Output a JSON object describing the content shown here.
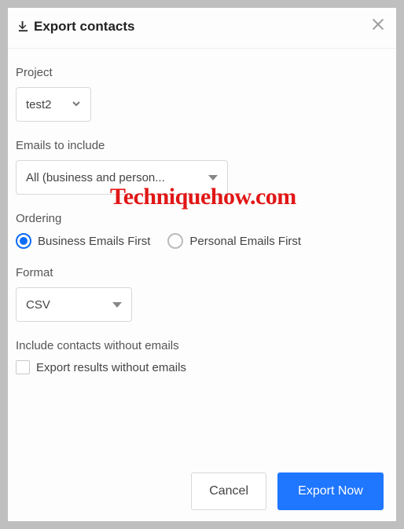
{
  "header": {
    "title": "Export contacts"
  },
  "watermark": "Techniquehow.com",
  "project": {
    "label": "Project",
    "value": "test2"
  },
  "emails": {
    "label": "Emails to include",
    "value": "All (business and person..."
  },
  "ordering": {
    "label": "Ordering",
    "options": [
      "Business Emails First",
      "Personal Emails First"
    ],
    "selected": 0
  },
  "format": {
    "label": "Format",
    "value": "CSV"
  },
  "noemail": {
    "label": "Include contacts without emails",
    "option": "Export results without emails",
    "checked": false
  },
  "footer": {
    "cancel": "Cancel",
    "export": "Export Now"
  }
}
